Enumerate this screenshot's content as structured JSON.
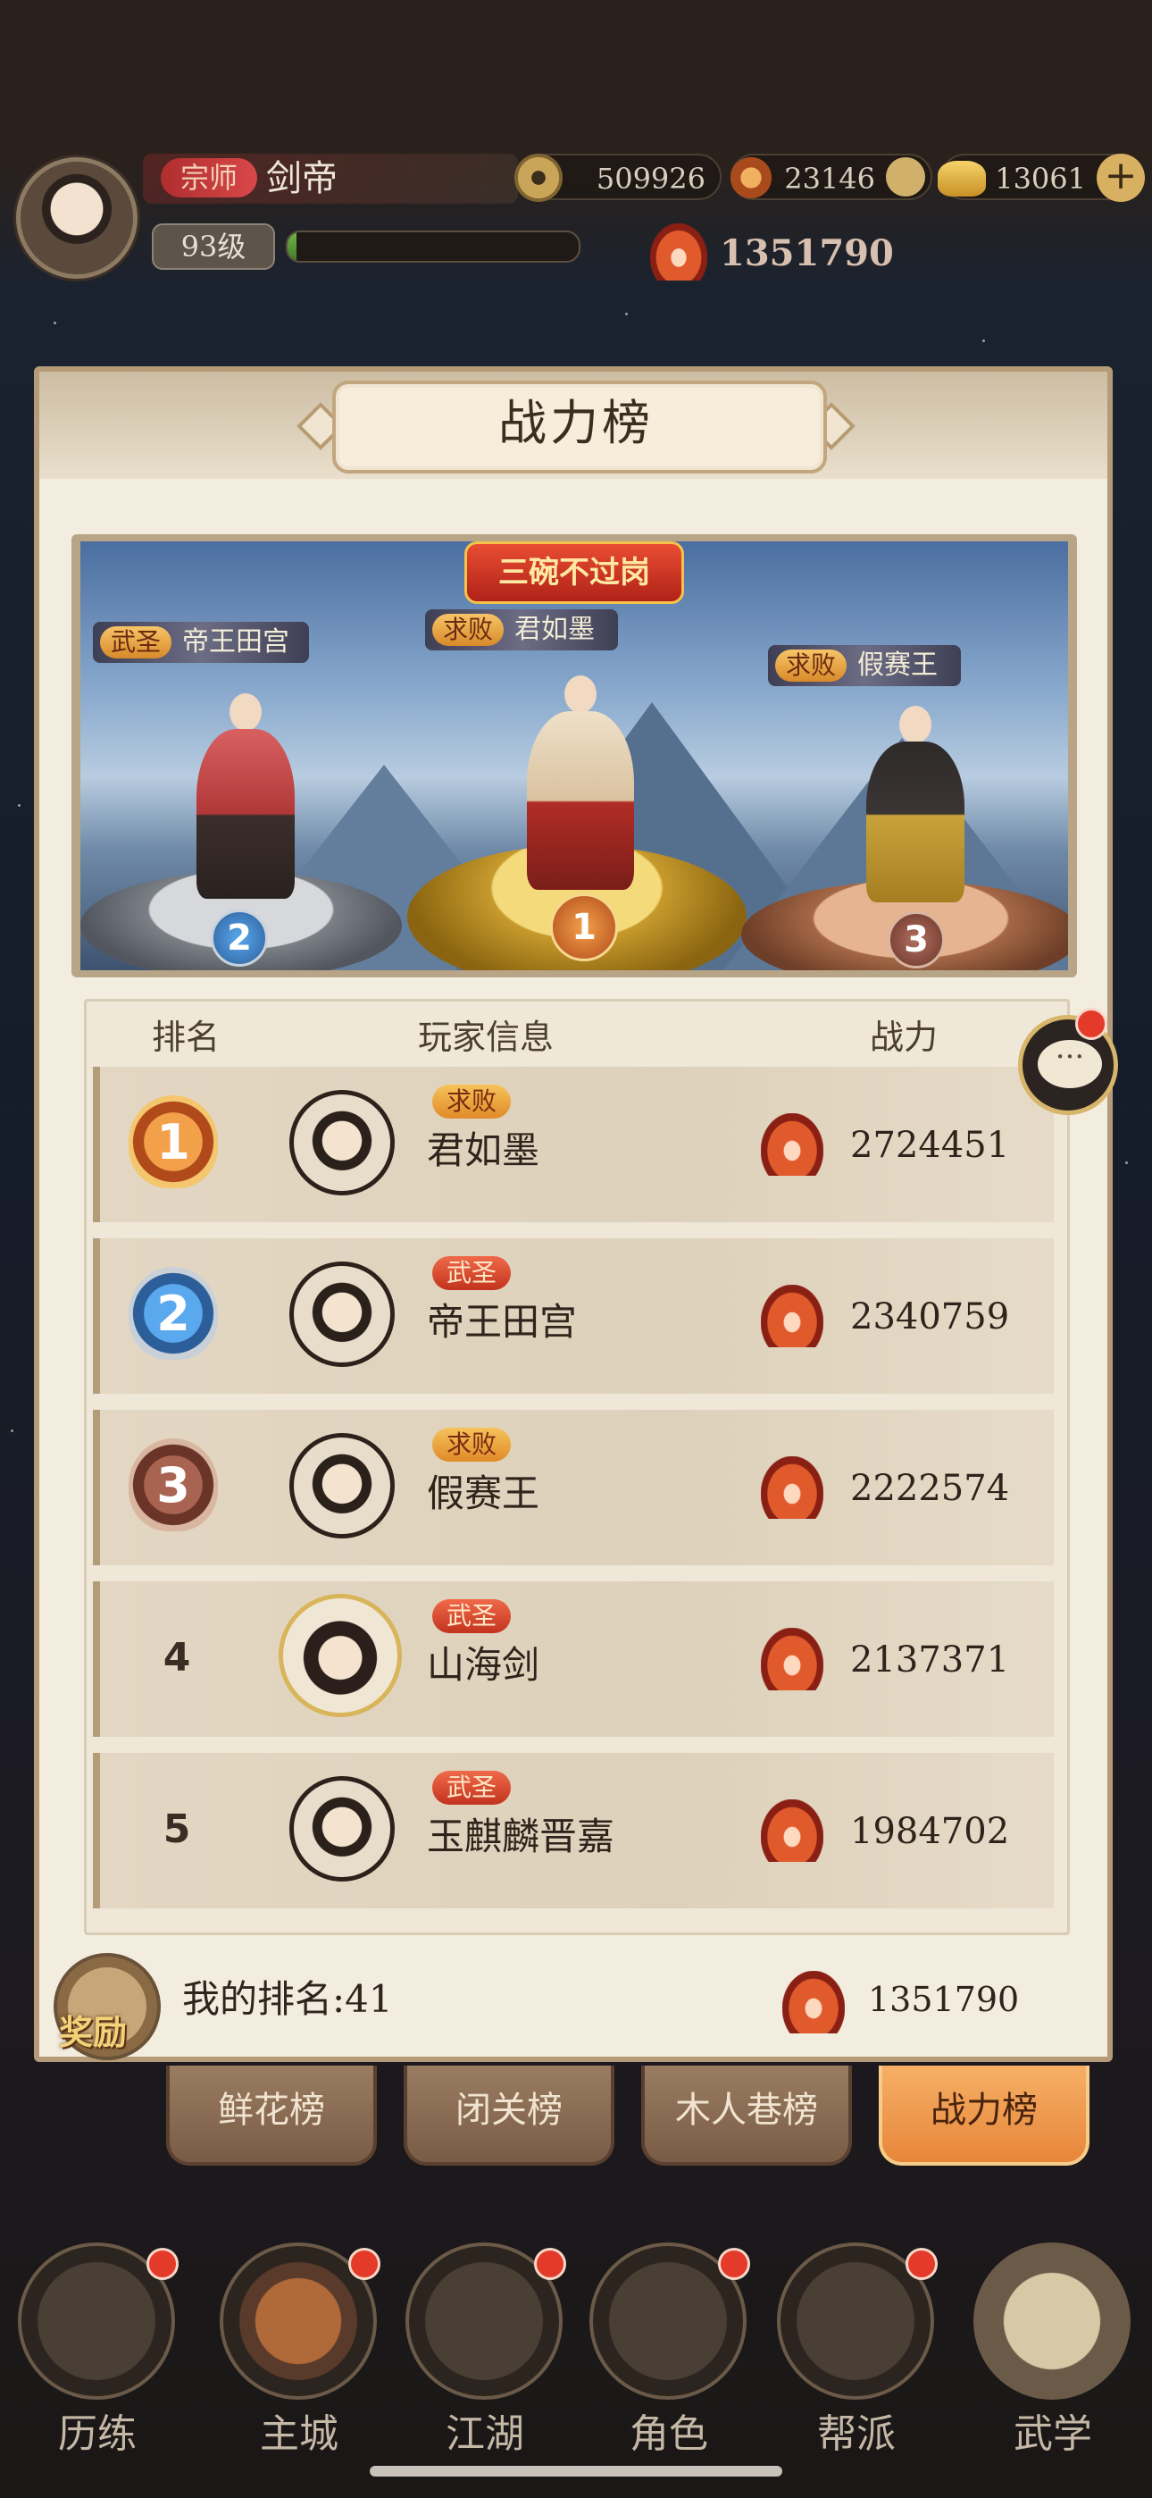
{
  "hud": {
    "rank_title": "宗师",
    "player_name": "剑帝",
    "level": "93级",
    "exp_fraction": 0.03,
    "coins": "509926",
    "jade": "23146",
    "gold": "13061",
    "power": "1351790",
    "plus": "+"
  },
  "panel": {
    "title": "战力榜"
  },
  "podium": {
    "banner": "三碗不过岗",
    "first": {
      "tag": "求败",
      "name": "君如墨",
      "num": "1"
    },
    "second": {
      "tag": "武圣",
      "name": "帝王田宫",
      "num": "2"
    },
    "third": {
      "tag": "求败",
      "name": "假赛王",
      "num": "3"
    }
  },
  "table": {
    "headers": {
      "rank": "排名",
      "info": "玩家信息",
      "power": "战力"
    },
    "rows": [
      {
        "rank": "1",
        "title": "求败",
        "name": "君如墨",
        "power": "2724451"
      },
      {
        "rank": "2",
        "title": "武圣",
        "name": "帝王田宫",
        "power": "2340759"
      },
      {
        "rank": "3",
        "title": "求败",
        "name": "假赛王",
        "power": "2222574"
      },
      {
        "rank": "4",
        "title": "武圣",
        "name": "山海剑",
        "power": "2137371"
      },
      {
        "rank": "5",
        "title": "武圣",
        "name": "玉麒麟晋嘉",
        "power": "1984702"
      }
    ]
  },
  "chat": {
    "glyph": "···"
  },
  "my_rank": {
    "reward_label": "奖励",
    "text": "我的排名:41",
    "power": "1351790"
  },
  "tabs": [
    {
      "label": "鲜花榜",
      "active": false
    },
    {
      "label": "闭关榜",
      "active": false
    },
    {
      "label": "木人巷榜",
      "active": false
    },
    {
      "label": "战力榜",
      "active": true
    }
  ],
  "nav": [
    {
      "label": "历练",
      "icon": "scroll-mask-icon"
    },
    {
      "label": "主城",
      "icon": "gate-icon"
    },
    {
      "label": "江湖",
      "icon": "sword-icon"
    },
    {
      "label": "角色",
      "icon": "hat-character-icon"
    },
    {
      "label": "帮派",
      "icon": "banner-icon"
    },
    {
      "label": "武学",
      "icon": "book-scroll-icon"
    }
  ],
  "colors": {
    "accent": "#e7863a",
    "panel": "#f3eddf",
    "red_dot": "#e33a2a"
  }
}
